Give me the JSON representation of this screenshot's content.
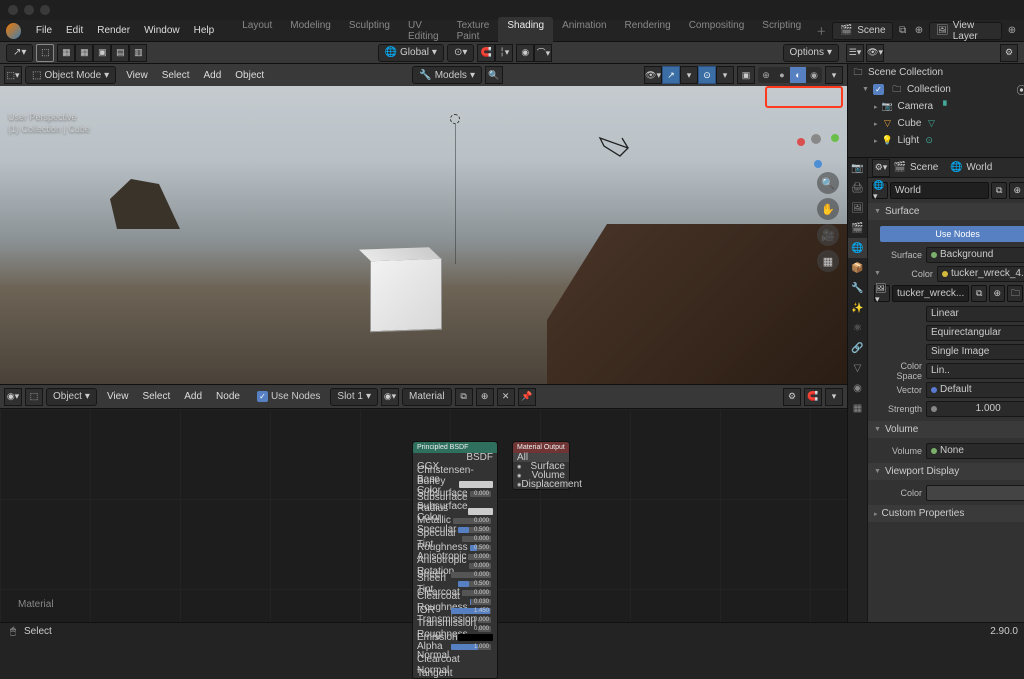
{
  "menus": [
    "File",
    "Edit",
    "Render",
    "Window",
    "Help"
  ],
  "workspaces": [
    "Layout",
    "Modeling",
    "Sculpting",
    "UV Editing",
    "Texture Paint",
    "Shading",
    "Animation",
    "Rendering",
    "Compositing",
    "Scripting"
  ],
  "active_workspace": "Shading",
  "scene_field": "Scene",
  "viewlayer_field": "View Layer",
  "toolbar_global": "Global",
  "options_btn": "Options",
  "vp_mode": "Object Mode",
  "vp_menus": [
    "View",
    "Select",
    "Add",
    "Object"
  ],
  "models_drop": "Models",
  "vp_info1": "User Perspective",
  "vp_info2": "(1) Collection | Cube",
  "ne_mode": "Object",
  "ne_menus": [
    "View",
    "Select",
    "Add",
    "Node"
  ],
  "use_nodes": "Use Nodes",
  "slot": "Slot 1",
  "material": "Material",
  "mat_label": "Material",
  "node1_title": "Principled BSDF",
  "node1_out": "BSDF",
  "node1_rows": [
    [
      "GGX",
      ""
    ],
    [
      "Christensen-Burley",
      ""
    ],
    [
      "Base Color",
      "col"
    ],
    [
      "Subsurface",
      "0.000"
    ],
    [
      "Subsurface Radius",
      ""
    ],
    [
      "Subsurface Color",
      "col"
    ],
    [
      "Metallic",
      "0.000"
    ],
    [
      "Specular",
      "0.500"
    ],
    [
      "Specular Tint",
      "0.000"
    ],
    [
      "Roughness",
      "0.500"
    ],
    [
      "Anisotropic",
      "0.000"
    ],
    [
      "Anisotropic Rotation",
      "0.000"
    ],
    [
      "Sheen",
      "0.000"
    ],
    [
      "Sheen Tint",
      "0.500"
    ],
    [
      "Clearcoat",
      "0.000"
    ],
    [
      "Clearcoat Roughness",
      "0.030"
    ],
    [
      "IOR",
      "1.450"
    ],
    [
      "Transmission",
      "0.000"
    ],
    [
      "Transmission Roughness",
      "0.000"
    ],
    [
      "Emission",
      "black"
    ],
    [
      "Alpha",
      "1.000"
    ],
    [
      "Normal",
      ""
    ],
    [
      "Clearcoat Normal",
      ""
    ],
    [
      "Tangent",
      ""
    ]
  ],
  "node2_title": "Material Output",
  "node2_rows": [
    "All",
    "Surface",
    "Volume",
    "Displacement"
  ],
  "outliner": {
    "root": "Scene Collection",
    "collection": "Collection",
    "items": [
      "Camera",
      "Cube",
      "Light"
    ]
  },
  "scene_tab": "Scene",
  "world_tab": "World",
  "world_block": "World",
  "texture_block": "tucker_wreck...",
  "surface_panel": "Surface",
  "use_nodes_btn": "Use Nodes",
  "surface_lbl": "Surface",
  "surface_val": "Background",
  "color_lbl": "Color",
  "color_val": "tucker_wreck_4..",
  "tex_interp": "Linear",
  "tex_proj": "Equirectangular",
  "tex_single": "Single Image",
  "colorspace_lbl": "Color Space",
  "colorspace_val": "Lin..",
  "vector_lbl": "Vector",
  "vector_val": "Default",
  "strength_lbl": "Strength",
  "strength_val": "1.000",
  "volume_panel": "Volume",
  "volume_lbl": "Volume",
  "volume_val": "None",
  "vpd_panel": "Viewport Display",
  "vpd_color": "Color",
  "custom_panel": "Custom Properties",
  "status_left": "Select",
  "version": "2.90.0"
}
